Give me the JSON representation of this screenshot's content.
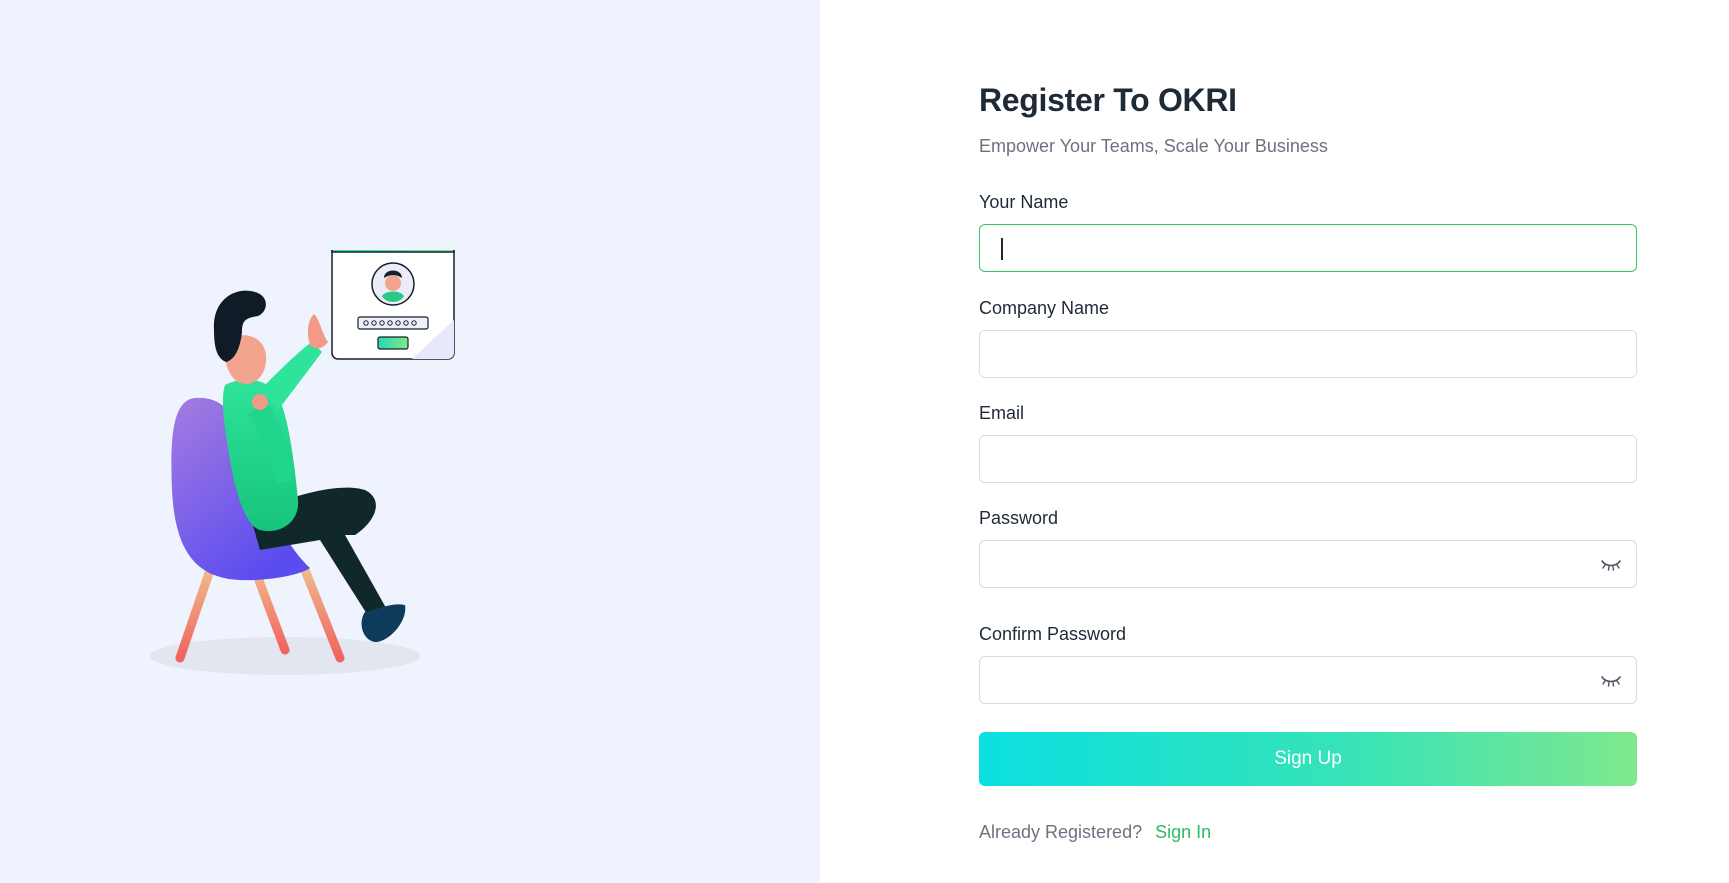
{
  "title": "Register To OKRI",
  "subtitle": "Empower Your Teams, Scale Your Business",
  "fields": {
    "name": {
      "label": "Your Name",
      "value": ""
    },
    "company": {
      "label": "Company Name",
      "value": ""
    },
    "email": {
      "label": "Email",
      "value": ""
    },
    "password": {
      "label": "Password",
      "value": "",
      "icon": "eye-closed-icon"
    },
    "confirm_password": {
      "label": "Confirm Password",
      "value": "",
      "icon": "eye-closed-icon"
    }
  },
  "signup_button": "Sign Up",
  "signin": {
    "prompt": "Already Registered?",
    "link": "Sign In"
  },
  "colors": {
    "accent": "#2fb96b",
    "focus_border": "#3cc46a",
    "button_gradient_start": "#0be0e0",
    "button_gradient_end": "#7fe88d",
    "left_background": "#eef3fd"
  }
}
